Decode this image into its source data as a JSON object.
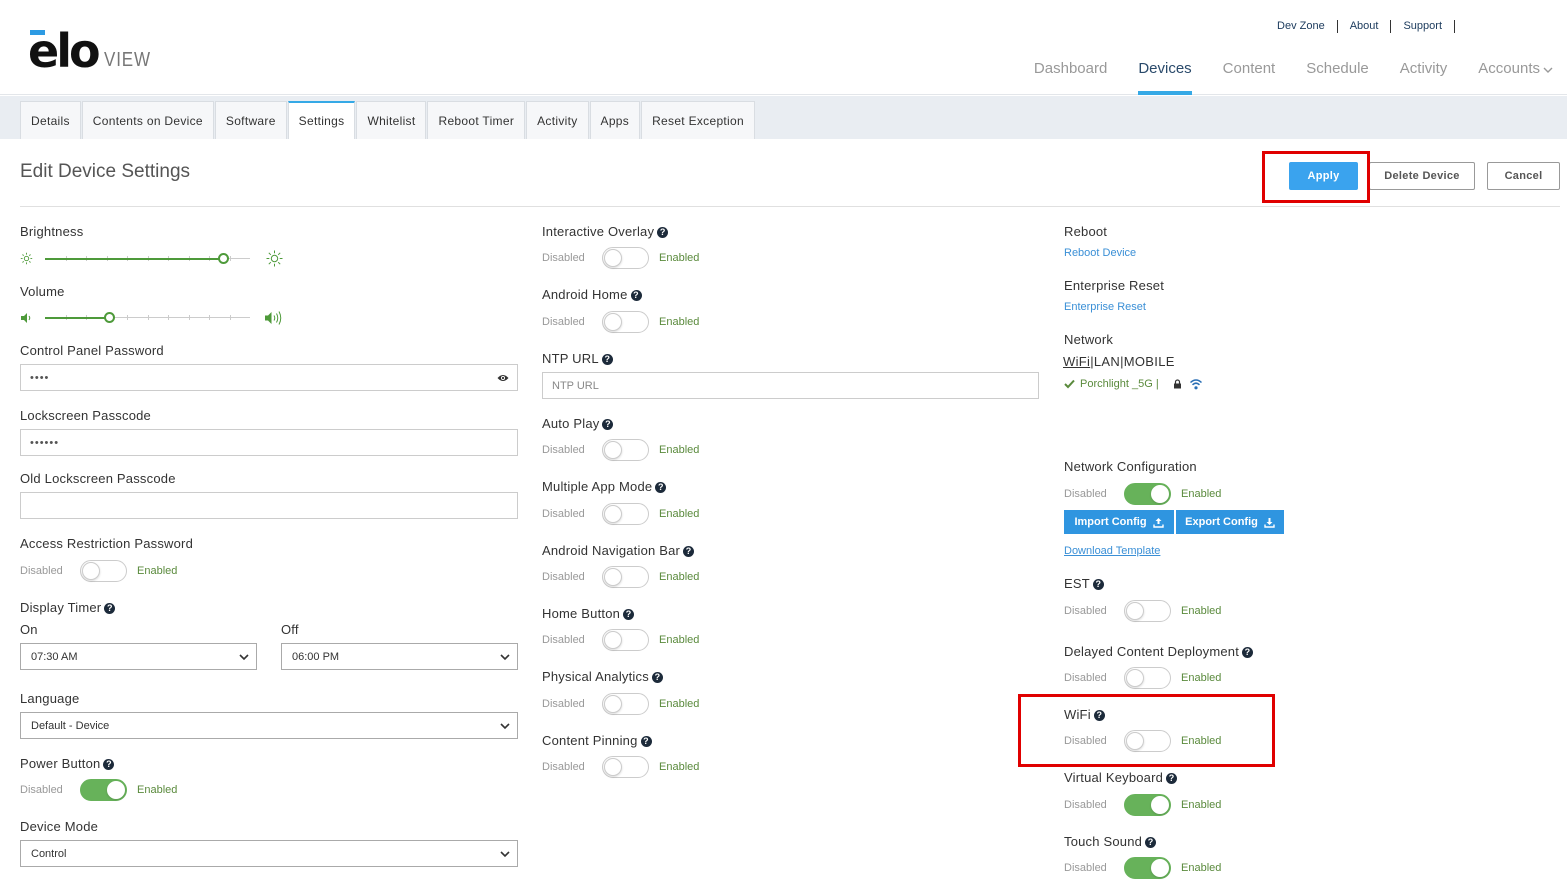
{
  "header": {
    "logo_main": "elo",
    "logo_sub": "VIEW",
    "top_links": [
      "Dev Zone",
      "About",
      "Support"
    ],
    "nav": [
      "Dashboard",
      "Devices",
      "Content",
      "Schedule",
      "Activity",
      "Accounts"
    ],
    "active_nav": "Devices"
  },
  "subtabs": [
    "Details",
    "Contents on Device",
    "Software",
    "Settings",
    "Whitelist",
    "Reboot Timer",
    "Activity",
    "Apps",
    "Reset Exception"
  ],
  "active_subtab": "Settings",
  "page": {
    "title": "Edit Device Settings",
    "apply": "Apply",
    "delete": "Delete Device",
    "cancel": "Cancel"
  },
  "toggle_text": {
    "disabled": "Disabled",
    "enabled": "Enabled"
  },
  "left": {
    "brightness": {
      "label": "Brightness",
      "level": 0.87
    },
    "volume": {
      "label": "Volume",
      "level": 0.31
    },
    "control_panel_password": {
      "label": "Control Panel Password",
      "value": "••••"
    },
    "lockscreen_passcode": {
      "label": "Lockscreen Passcode",
      "value": "••••••"
    },
    "old_lockscreen_passcode": {
      "label": "Old Lockscreen Passcode",
      "value": ""
    },
    "access_restriction_password": {
      "label": "Access Restriction Password",
      "on": false
    },
    "display_timer": {
      "label": "Display Timer",
      "on_label": "On",
      "off_label": "Off",
      "on_value": "07:30 AM",
      "off_value": "06:00 PM"
    },
    "language": {
      "label": "Language",
      "value": "Default - Device"
    },
    "power_button": {
      "label": "Power Button",
      "on": true
    },
    "device_mode": {
      "label": "Device Mode",
      "value": "Control"
    }
  },
  "middle": {
    "interactive_overlay": {
      "label": "Interactive Overlay",
      "on": false
    },
    "android_home": {
      "label": "Android Home",
      "on": false
    },
    "ntp_url": {
      "label": "NTP URL",
      "placeholder": "NTP URL"
    },
    "auto_play": {
      "label": "Auto Play",
      "on": false
    },
    "multiple_app_mode": {
      "label": "Multiple App Mode",
      "on": false
    },
    "android_navigation_bar": {
      "label": "Android Navigation Bar",
      "on": false
    },
    "home_button": {
      "label": "Home Button",
      "on": false
    },
    "physical_analytics": {
      "label": "Physical Analytics",
      "on": false
    },
    "content_pinning": {
      "label": "Content Pinning",
      "on": false
    }
  },
  "right": {
    "reboot": {
      "label": "Reboot",
      "link": "Reboot Device"
    },
    "enterprise_reset": {
      "label": "Enterprise Reset",
      "link": "Enterprise Reset"
    },
    "network": {
      "label": "Network",
      "tab_wifi": "WiFi",
      "tab_lan": "LAN",
      "tab_mobile": "MOBILE",
      "ssid": "Porchlight _5G |"
    },
    "network_configuration": {
      "label": "Network Configuration",
      "on": true,
      "import": "Import Config",
      "export": "Export Config",
      "download": "Download Template"
    },
    "est": {
      "label": "EST",
      "on": false
    },
    "delayed_content_deployment": {
      "label": "Delayed Content Deployment",
      "on": false
    },
    "wifi": {
      "label": "WiFi",
      "on": false
    },
    "virtual_keyboard": {
      "label": "Virtual Keyboard",
      "on": true
    },
    "touch_sound": {
      "label": "Touch Sound",
      "on": true
    }
  },
  "colors": {
    "accent": "#35a9e6",
    "toggle_on": "#67b25a",
    "highlight": "#e00000"
  }
}
